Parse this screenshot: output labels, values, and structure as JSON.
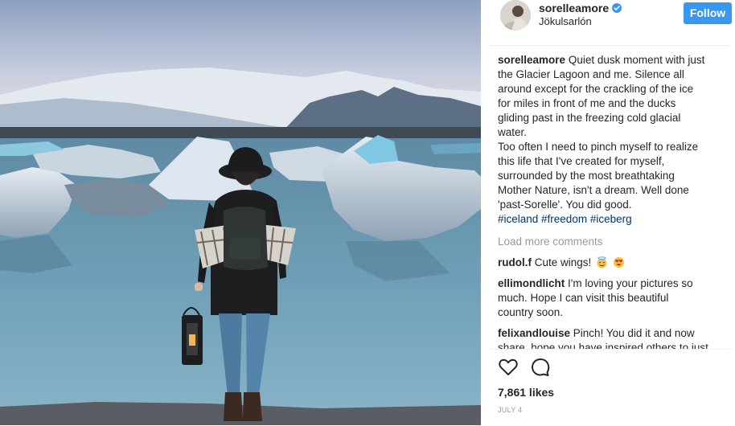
{
  "post": {
    "username": "sorelleamore",
    "location": "Jökulsarlón",
    "follow_label": "Follow",
    "caption_lines": [
      "Quiet dusk moment with just",
      "the Glacier Lagoon and me. Silence all",
      "around except for the crackling of the ice",
      "for miles in front of me and the ducks",
      "gliding past in the freezing cold glacial",
      "water.",
      "Too often I need to pinch myself to realize",
      "this life that I've created for myself,",
      "surrounded by the most breathtaking",
      "Mother Nature, isn't a dream. Well done",
      "'past-Sorelle'. You did good."
    ],
    "hashtags": "#iceland #freedom #iceberg",
    "load_more": "Load more comments",
    "comments": [
      {
        "user": "rudol.f",
        "text": "Cute wings!"
      },
      {
        "user": "ellimondlicht",
        "lines": [
          "I'm loving your pictures so",
          "much. Hope I can visit this beautiful",
          "country soon."
        ]
      },
      {
        "user": "felixandlouise",
        "lines": [
          "Pinch! You did it and now",
          "share, hope you have inspired others to just"
        ]
      }
    ],
    "likes": "7,861 likes",
    "date": "JULY 4"
  },
  "icons": {
    "verified": "verified-badge-icon",
    "like": "heart-icon",
    "comment": "comment-bubble-icon",
    "emoji1": "smiling-face-with-halo-icon",
    "emoji2": "heart-eyes-face-icon"
  },
  "colors": {
    "follow_button": "#3897f0",
    "hashtag": "#003569",
    "muted": "#999999"
  }
}
